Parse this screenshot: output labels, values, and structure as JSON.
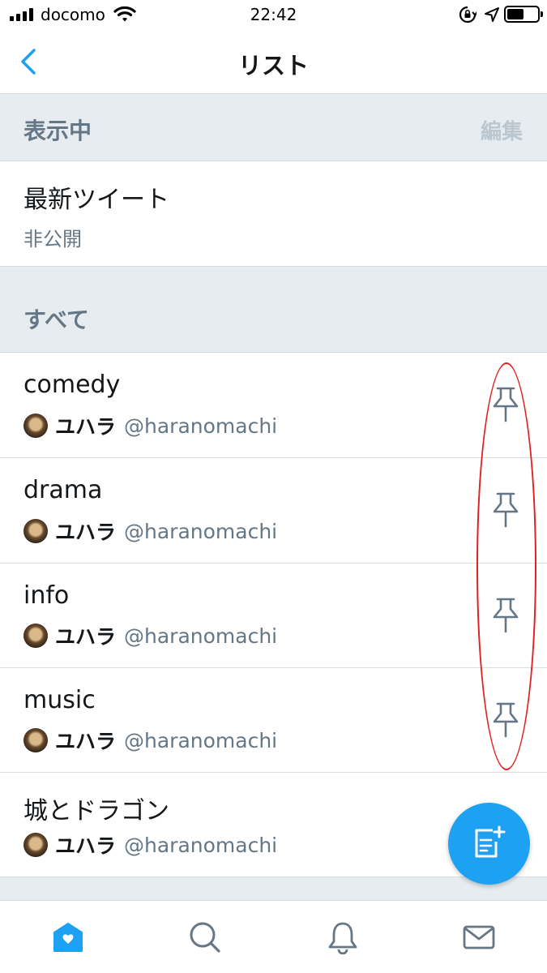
{
  "status_bar": {
    "carrier": "docomo",
    "time": "22:42",
    "battery_level": 0.5
  },
  "nav": {
    "title": "リスト",
    "back_icon": "chevron-left-icon"
  },
  "pinned_section": {
    "title": "表示中",
    "edit_label": "編集"
  },
  "pinned_items": [
    {
      "name": "最新ツイート",
      "visibility": "非公開"
    }
  ],
  "all_section": {
    "title": "すべて"
  },
  "lists": [
    {
      "name": "comedy",
      "owner_name": "ユハラ",
      "owner_handle": "@haranomachi"
    },
    {
      "name": "drama",
      "owner_name": "ユハラ",
      "owner_handle": "@haranomachi"
    },
    {
      "name": "info",
      "owner_name": "ユハラ",
      "owner_handle": "@haranomachi"
    },
    {
      "name": "music",
      "owner_name": "ユハラ",
      "owner_handle": "@haranomachi"
    },
    {
      "name": "城とドラゴン",
      "owner_name": "ユハラ",
      "owner_handle": "@haranomachi"
    }
  ],
  "fab": {
    "icon": "new-list-icon"
  },
  "tab_bar": {
    "tabs": [
      {
        "icon": "home-icon",
        "active": true
      },
      {
        "icon": "search-icon",
        "active": false
      },
      {
        "icon": "bell-icon",
        "active": false
      },
      {
        "icon": "mail-icon",
        "active": false
      }
    ]
  },
  "colors": {
    "accent": "#1da1f2",
    "section_bg": "#e6ecf0",
    "secondary_text": "#657786",
    "annotation": "#e02020"
  }
}
